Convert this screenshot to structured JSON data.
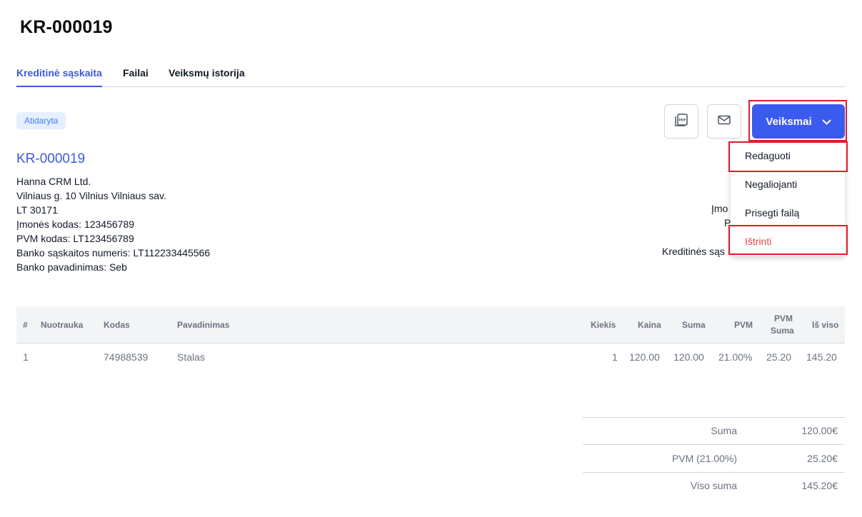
{
  "page": {
    "title": "KR-000019"
  },
  "tabs": [
    {
      "label": "Kreditinė sąskaita",
      "active": true
    },
    {
      "label": "Failai",
      "active": false
    },
    {
      "label": "Veiksmų istorija",
      "active": false
    }
  ],
  "status": {
    "label": "Atidaryta"
  },
  "toolbar": {
    "pdf_icon": "pdf-icon",
    "mail_icon": "mail-icon",
    "actions_label": "Veiksmai",
    "actions_icon": "chevron-down-icon"
  },
  "dropdown": {
    "items": [
      {
        "label": "Redaguoti"
      },
      {
        "label": "Negaliojanti"
      },
      {
        "label": "Prisegti failą"
      },
      {
        "label": "Ištrinti"
      }
    ]
  },
  "invoice": {
    "number": "KR-000019",
    "company": {
      "name": "Hanna CRM Ltd.",
      "address": "Vilniaus g. 10 Vilnius Vilniaus sav.",
      "postal": "LT 30171",
      "company_code": "Įmonės kodas: 123456789",
      "vat_code": "PVM kodas: LT123456789",
      "bank_account": "Banko sąskaitos numeris: LT112233445566",
      "bank_name": "Banko pavadinimas: Seb"
    },
    "right_fragments": {
      "line1": "Įmo",
      "line2": "P",
      "line3": "Kreditinės sąs"
    }
  },
  "table": {
    "headers": {
      "num": "#",
      "photo": "Nuotrauka",
      "code": "Kodas",
      "name": "Pavadinimas",
      "qty": "Kiekis",
      "price": "Kaina",
      "sum": "Suma",
      "vat": "PVM",
      "vat_sum_1": "PVM",
      "vat_sum_2": "Suma",
      "total": "Iš viso"
    },
    "rows": [
      {
        "num": "1",
        "photo": "",
        "code": "74988539",
        "name": "Stalas",
        "qty": "1",
        "price": "120.00",
        "sum": "120.00",
        "vat": "21.00%",
        "vat_sum": "25.20",
        "total": "145.20"
      }
    ]
  },
  "totals": {
    "sum_label": "Suma",
    "sum_value": "120.00€",
    "vat_label": "PVM (21.00%)",
    "vat_value": "25.20€",
    "total_label": "Viso suma",
    "total_value": "145.20€"
  },
  "colors": {
    "accent": "#3b5bef",
    "link": "#3b5bdb",
    "danger": "#e5484d",
    "highlight": "#e11d2a"
  }
}
